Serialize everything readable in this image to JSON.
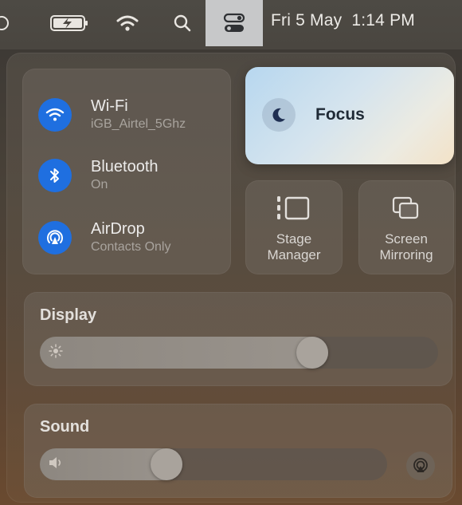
{
  "menubar": {
    "date": "Fri 5 May",
    "time": "1:14 PM",
    "icons": [
      "partial-circle-icon",
      "battery-charging-icon",
      "wifi-icon",
      "search-icon",
      "control-center-icon"
    ]
  },
  "control_center": {
    "connectivity": [
      {
        "title": "Wi-Fi",
        "subtitle": "iGB_Airtel_5Ghz",
        "icon": "wifi-icon"
      },
      {
        "title": "Bluetooth",
        "subtitle": "On",
        "icon": "bluetooth-icon"
      },
      {
        "title": "AirDrop",
        "subtitle": "Contacts Only",
        "icon": "airdrop-icon"
      }
    ],
    "focus": {
      "label": "Focus",
      "icon": "moon-icon"
    },
    "stage_manager": {
      "line1": "Stage",
      "line2": "Manager",
      "icon": "stage-manager-icon"
    },
    "screen_mirroring": {
      "line1": "Screen",
      "line2": "Mirroring",
      "icon": "screen-mirroring-icon"
    },
    "display": {
      "title": "Display",
      "brightness": 0.7,
      "icon": "sun-icon"
    },
    "sound": {
      "title": "Sound",
      "volume": 0.35,
      "icon": "speaker-icon",
      "output_icon": "airplay-audio-icon"
    }
  },
  "colors": {
    "accent": "#1f6fe0",
    "focus_gradient_start": "#b7d7ef",
    "focus_gradient_end": "#f3e2c7"
  }
}
